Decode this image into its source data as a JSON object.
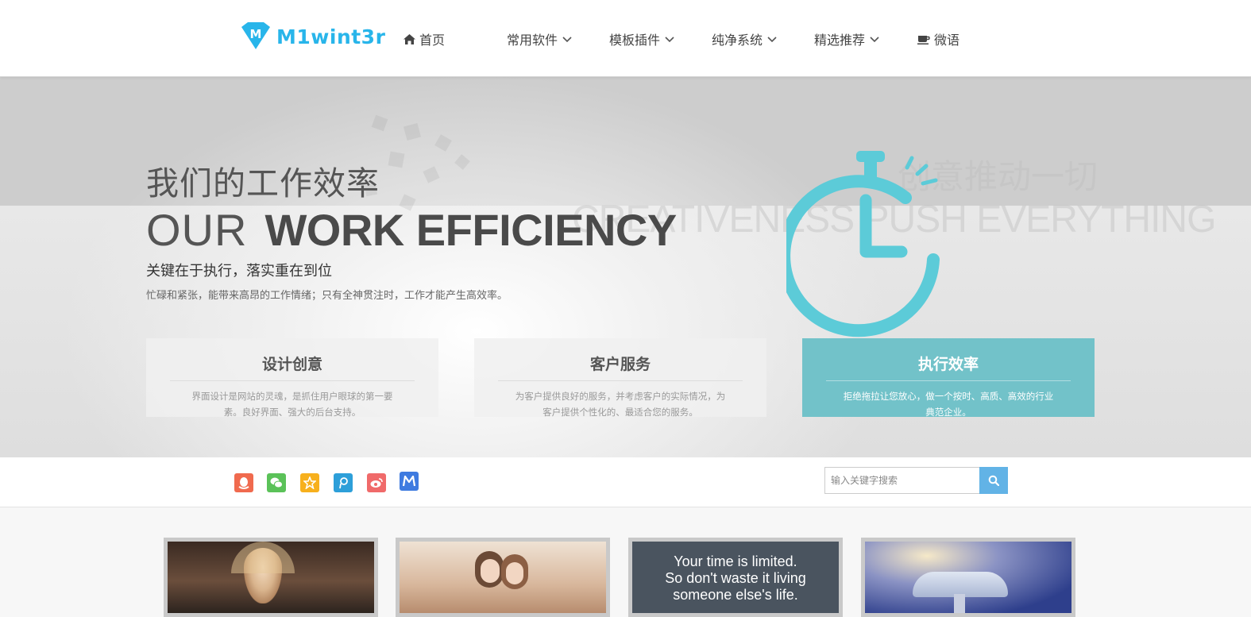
{
  "brand": {
    "logo_text": "M1wint3r",
    "accent": "#28b5ea",
    "active_teal": "#72c2c9"
  },
  "nav": {
    "items": [
      {
        "label": "首页",
        "icon": "home-icon"
      },
      {
        "label": "常用软件",
        "icon": "chevron-down-icon"
      },
      {
        "label": "模板插件",
        "icon": "chevron-down-icon"
      },
      {
        "label": "纯净系统",
        "icon": "chevron-down-icon"
      },
      {
        "label": "精选推荐",
        "icon": "chevron-down-icon"
      },
      {
        "label": "微语",
        "icon": "coffee-icon"
      }
    ]
  },
  "hero": {
    "title_cn": "我们的工作效率",
    "title_en_thin": "OUR",
    "title_en_bold": "WORK EFFICIENCY",
    "subtitle": "关键在于执行，落实重在到位",
    "description": "忙碌和紧张，能带来高昂的工作情绪；只有全神贯注时，工作才能产生高效率。",
    "bg_text_cn": "创意推动一切",
    "bg_text_en": "CREATIVENESS PUSH EVERYTHING",
    "clock_icon": "stopwatch-icon",
    "features": [
      {
        "title": "设计创意",
        "desc": "界面设计是网站的灵魂，是抓住用户眼球的第一要素。良好界面、强大的后台支持。"
      },
      {
        "title": "客户服务",
        "desc": "为客户提供良好的服务，并考虑客户的实际情况，为客户提供个性化的、最适合您的服务。"
      },
      {
        "title": "执行效率",
        "desc": "拒绝拖拉让您放心，做一个按时、高质、高效的行业典范企业。"
      }
    ]
  },
  "toolbar": {
    "social": [
      {
        "name": "qq-icon",
        "color": "#f06a4e"
      },
      {
        "name": "wechat-icon",
        "color": "#5bc259"
      },
      {
        "name": "qzone-icon",
        "color": "#f7b01d"
      },
      {
        "name": "tencent-weibo-icon",
        "color": "#2d9fd9"
      },
      {
        "name": "weibo-icon",
        "color": "#f06a6a"
      },
      {
        "name": "m-brand-icon",
        "color": "#3f7be0"
      }
    ],
    "search_placeholder": "输入关键字搜索",
    "search_icon": "search-icon"
  },
  "cards": [
    {
      "image": "woman-portrait-image"
    },
    {
      "image": "two-girls-sofa-image"
    },
    {
      "image": "quote-image",
      "quote": "Your time is limited.\nSo don't waste it living\nsomeone else's life."
    },
    {
      "image": "mushroom-image"
    }
  ]
}
